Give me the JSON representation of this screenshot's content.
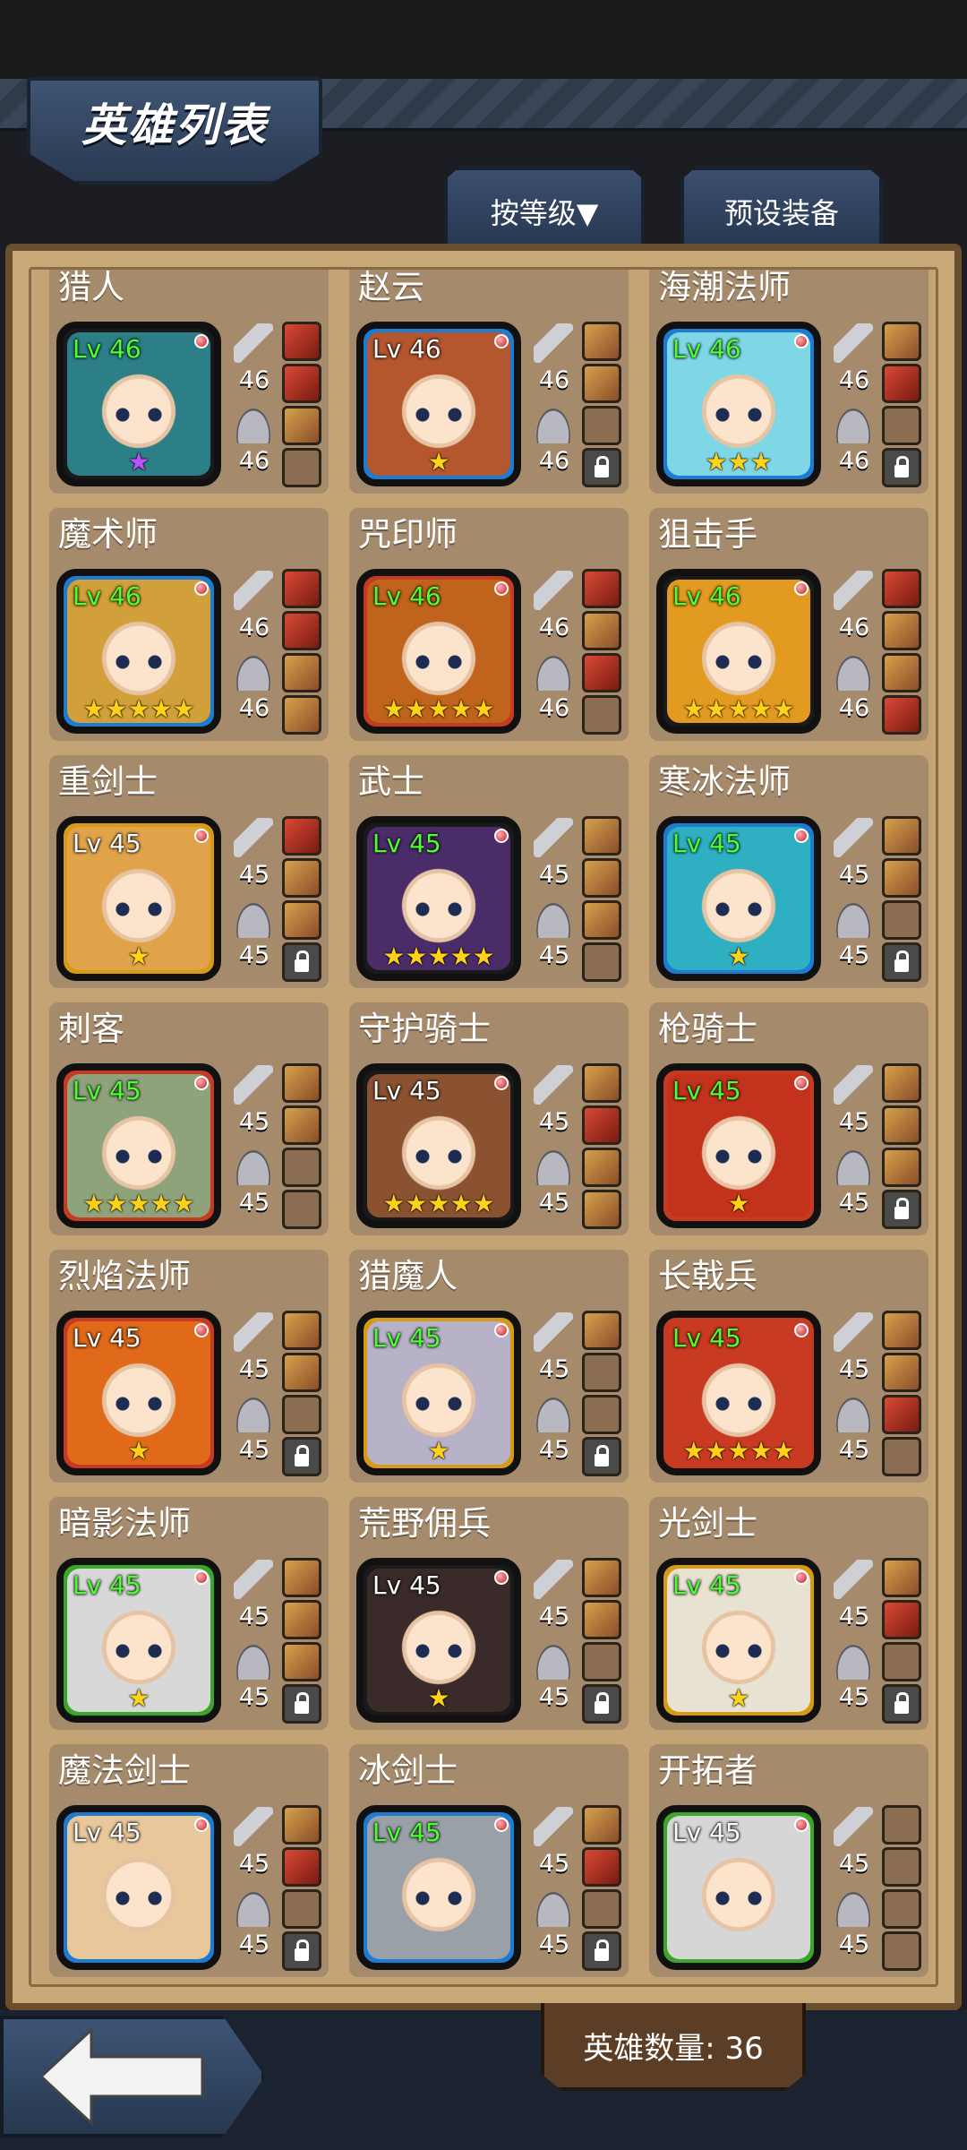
{
  "header": {
    "title": "英雄列表"
  },
  "tabs": {
    "sort": "按等级▼",
    "preset": "预设装备"
  },
  "footer": {
    "hero_count": "英雄数量: 36"
  },
  "heroes": [
    {
      "name": "猎人",
      "level": "Lv 46",
      "lv_color": "green",
      "atk": "46",
      "def": "46",
      "stars": "★",
      "star_color": "purple",
      "hair": "#2c7f86",
      "frame": "#1a1a1a",
      "slots": [
        "equip-red",
        "equip-red",
        "equip",
        "empty"
      ]
    },
    {
      "name": "赵云",
      "level": "Lv 46",
      "lv_color": "white",
      "atk": "46",
      "def": "46",
      "stars": "★",
      "star_color": "gold",
      "hair": "#b4562e",
      "frame": "#1d7bd1",
      "slots": [
        "equip",
        "equip",
        "empty",
        "lock"
      ]
    },
    {
      "name": "海潮法师",
      "level": "Lv 46",
      "lv_color": "green",
      "atk": "46",
      "def": "46",
      "stars": "★★★",
      "star_color": "gold",
      "hair": "#7fd7e6",
      "frame": "#1d7bd1",
      "slots": [
        "equip",
        "equip-red",
        "empty",
        "lock"
      ]
    },
    {
      "name": "魔术师",
      "level": "Lv 46",
      "lv_color": "green",
      "atk": "46",
      "def": "46",
      "stars": "★★★★★",
      "star_color": "gold",
      "hair": "#d1a03a",
      "frame": "#1d7bd1",
      "slots": [
        "equip-red",
        "equip-red",
        "equip",
        "equip"
      ]
    },
    {
      "name": "咒印师",
      "level": "Lv 46",
      "lv_color": "green",
      "atk": "46",
      "def": "46",
      "stars": "★★★★★",
      "star_color": "gold",
      "hair": "#c0631c",
      "frame": "#c63a22",
      "slots": [
        "equip-red",
        "equip",
        "equip-red",
        "empty"
      ]
    },
    {
      "name": "狙击手",
      "level": "Lv 46",
      "lv_color": "green",
      "atk": "46",
      "def": "46",
      "stars": "★★★★★",
      "star_color": "gold",
      "hair": "#e39a20",
      "frame": "#1a1a1a",
      "slots": [
        "equip-red",
        "equip",
        "equip",
        "equip-red"
      ]
    },
    {
      "name": "重剑士",
      "level": "Lv 45",
      "lv_color": "white",
      "atk": "45",
      "def": "45",
      "stars": "★",
      "star_color": "gold",
      "hair": "#e0a34a",
      "frame": "#d79a14",
      "slots": [
        "equip-red",
        "equip",
        "equip",
        "lock"
      ]
    },
    {
      "name": "武士",
      "level": "Lv 45",
      "lv_color": "green",
      "atk": "45",
      "def": "45",
      "stars": "★★★★★",
      "star_color": "gold",
      "hair": "#4a2c68",
      "frame": "#1a1a1a",
      "slots": [
        "equip",
        "equip",
        "equip",
        "empty"
      ]
    },
    {
      "name": "寒冰法师",
      "level": "Lv 45",
      "lv_color": "green",
      "atk": "45",
      "def": "45",
      "stars": "★",
      "star_color": "gold",
      "hair": "#2fb0c2",
      "frame": "#1d7bd1",
      "slots": [
        "equip",
        "equip",
        "empty",
        "lock"
      ]
    },
    {
      "name": "刺客",
      "level": "Lv 45",
      "lv_color": "green",
      "atk": "45",
      "def": "45",
      "stars": "★★★★★",
      "star_color": "gold",
      "hair": "#8ea27c",
      "frame": "#c63a22",
      "slots": [
        "equip",
        "equip",
        "empty",
        "empty"
      ]
    },
    {
      "name": "守护骑士",
      "level": "Lv 45",
      "lv_color": "white",
      "atk": "45",
      "def": "45",
      "stars": "★★★★★",
      "star_color": "gold",
      "hair": "#8a5230",
      "frame": "#1a1a1a",
      "slots": [
        "equip",
        "equip-red",
        "equip",
        "equip"
      ]
    },
    {
      "name": "枪骑士",
      "level": "Lv 45",
      "lv_color": "green",
      "atk": "45",
      "def": "45",
      "stars": "★",
      "star_color": "gold",
      "hair": "#c2321c",
      "frame": "#c63a22",
      "slots": [
        "equip",
        "equip",
        "equip",
        "lock"
      ]
    },
    {
      "name": "烈焰法师",
      "level": "Lv 45",
      "lv_color": "white",
      "atk": "45",
      "def": "45",
      "stars": "★",
      "star_color": "gold",
      "hair": "#e06a1a",
      "frame": "#c63a22",
      "slots": [
        "equip",
        "equip",
        "empty",
        "lock"
      ]
    },
    {
      "name": "猎魔人",
      "level": "Lv 45",
      "lv_color": "green",
      "atk": "45",
      "def": "45",
      "stars": "★",
      "star_color": "gold",
      "hair": "#b8b2c8",
      "frame": "#d79a14",
      "slots": [
        "equip",
        "empty",
        "empty",
        "lock"
      ]
    },
    {
      "name": "长戟兵",
      "level": "Lv 45",
      "lv_color": "green",
      "atk": "45",
      "def": "45",
      "stars": "★★★★★",
      "star_color": "gold",
      "hair": "#c83a22",
      "frame": "#c63a22",
      "slots": [
        "equip",
        "equip",
        "equip-red",
        "empty"
      ]
    },
    {
      "name": "暗影法师",
      "level": "Lv 45",
      "lv_color": "green",
      "atk": "45",
      "def": "45",
      "stars": "★",
      "star_color": "gold",
      "hair": "#d8d8d8",
      "frame": "#3aa62a",
      "slots": [
        "equip",
        "equip",
        "equip",
        "lock"
      ]
    },
    {
      "name": "荒野佣兵",
      "level": "Lv 45",
      "lv_color": "white",
      "atk": "45",
      "def": "45",
      "stars": "★",
      "star_color": "gold",
      "hair": "#3a2a2a",
      "frame": "#1a1a1a",
      "slots": [
        "equip",
        "equip",
        "empty",
        "lock"
      ]
    },
    {
      "name": "光剑士",
      "level": "Lv 45",
      "lv_color": "green",
      "atk": "45",
      "def": "45",
      "stars": "★",
      "star_color": "gold",
      "hair": "#e8e2d2",
      "frame": "#d79a14",
      "slots": [
        "equip",
        "equip-red",
        "empty",
        "lock"
      ]
    },
    {
      "name": "魔法剑士",
      "level": "Lv 45",
      "lv_color": "white",
      "atk": "45",
      "def": "45",
      "stars": "",
      "star_color": "gold",
      "hair": "#e8c79a",
      "frame": "#1d7bd1",
      "slots": [
        "equip",
        "equip-red",
        "empty",
        "lock"
      ]
    },
    {
      "name": "冰剑士",
      "level": "Lv 45",
      "lv_color": "green",
      "atk": "45",
      "def": "45",
      "stars": "",
      "star_color": "gold",
      "hair": "#9aa0a8",
      "frame": "#1d7bd1",
      "slots": [
        "equip",
        "equip-red",
        "empty",
        "lock"
      ]
    },
    {
      "name": "开拓者",
      "level": "Lv 45",
      "lv_color": "white",
      "atk": "45",
      "def": "45",
      "stars": "",
      "star_color": "gold",
      "hair": "#d6d6d6",
      "frame": "#3aa62a",
      "slots": [
        "empty",
        "empty",
        "empty",
        "empty"
      ]
    }
  ]
}
